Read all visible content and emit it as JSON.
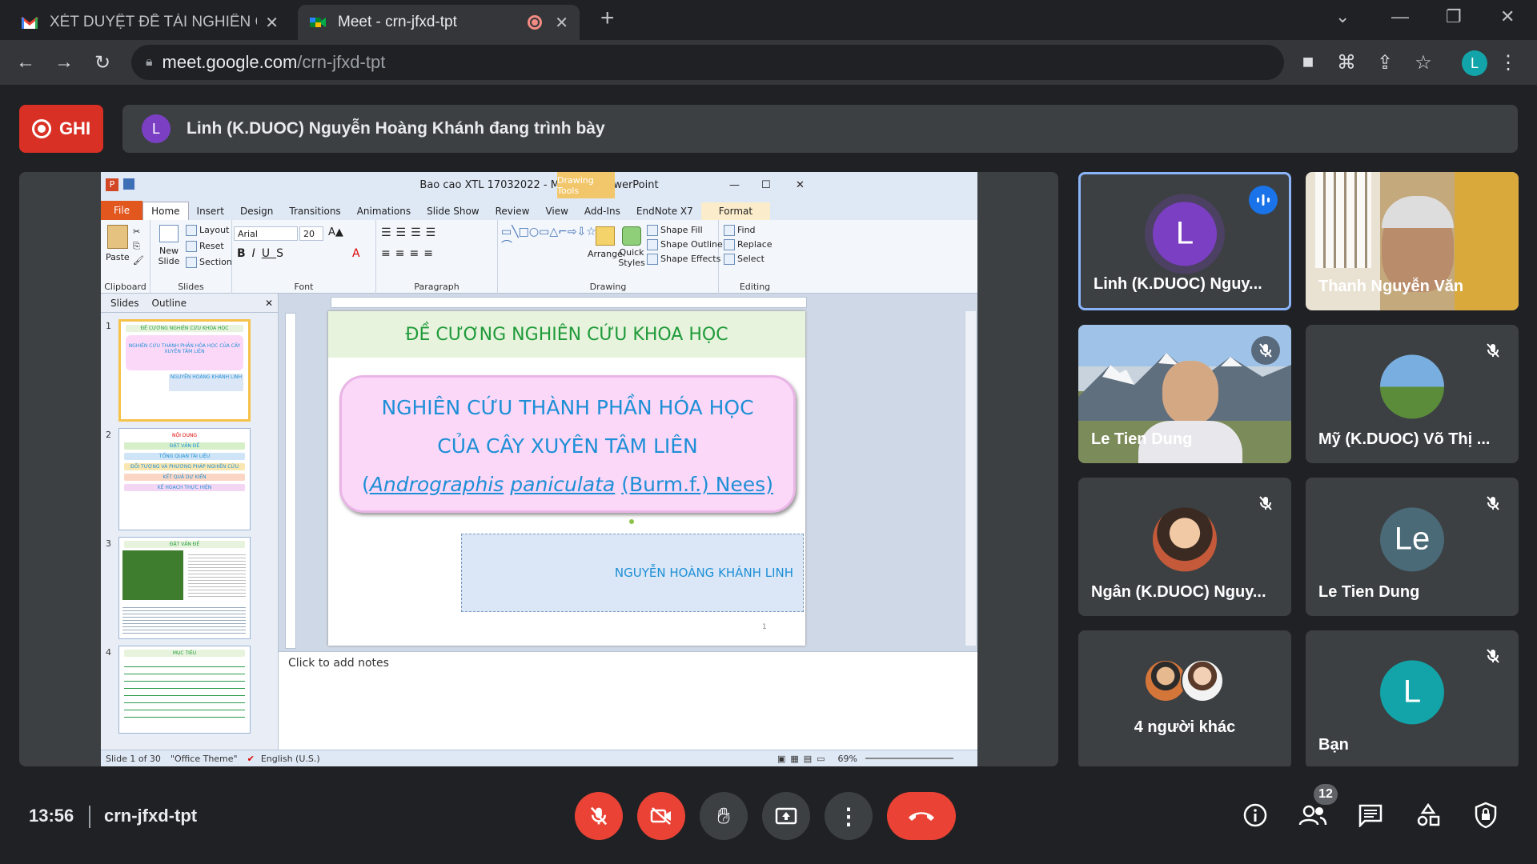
{
  "browser": {
    "tabs": [
      {
        "title": "XÉT DUYỆT ĐỀ TÀI NGHIÊN CỨU",
        "favicon": "gmail-icon"
      },
      {
        "title": "Meet - crn-jfxd-tpt",
        "favicon": "meet-icon"
      }
    ],
    "url_host": "meet.google.com",
    "url_path": "/crn-jfxd-tpt",
    "profile_initial": "L"
  },
  "meet": {
    "record_label": "GHI",
    "presenter_initial": "L",
    "presenting_text": "Linh (K.DUOC) Nguyễn Hoàng Khánh đang trình bày",
    "time": "13:56",
    "meeting_code": "crn-jfxd-tpt",
    "participant_count": "12",
    "participants": [
      {
        "name": "Linh (K.DUOC) Nguy...",
        "initial": "L",
        "color": "#7b3fc4",
        "speaking": true
      },
      {
        "name": "Thanh Nguyễn Văn",
        "type": "video"
      },
      {
        "name": "Le Tien Dung",
        "type": "video",
        "muted": true
      },
      {
        "name": "Mỹ (K.DUOC) Võ Thị ...",
        "muted": true
      },
      {
        "name": "Ngân (K.DUOC) Nguy...",
        "muted": true
      },
      {
        "name": "Le Tien Dung",
        "initial": "Le",
        "color": "#4a6a78",
        "muted": true
      },
      {
        "name": "4 người khác"
      },
      {
        "name": "Bạn",
        "initial": "L",
        "color": "#12a4a8",
        "muted": true
      }
    ]
  },
  "ppt": {
    "window_title": "Bao cao XTL 17032022 - Microsoft PowerPoint",
    "drawing_tools": "Drawing Tools",
    "tabs": [
      "File",
      "Home",
      "Insert",
      "Design",
      "Transitions",
      "Animations",
      "Slide Show",
      "Review",
      "View",
      "Add-Ins",
      "EndNote X7",
      "Format"
    ],
    "ribbon": {
      "clipboard": "Clipboard",
      "slides": "Slides",
      "font": "Font",
      "paragraph": "Paragraph",
      "drawing": "Drawing",
      "editing": "Editing",
      "paste": "Paste",
      "new_slide": "New Slide",
      "layout": "Layout",
      "reset": "Reset",
      "section": "Section",
      "font_name": "Arial",
      "font_size": "20",
      "arrange": "Arrange",
      "quick_styles": "Quick Styles",
      "shape_fill": "Shape Fill",
      "shape_outline": "Shape Outline",
      "shape_effects": "Shape Effects",
      "find": "Find",
      "replace": "Replace",
      "select": "Select"
    },
    "pane_tabs": [
      "Slides",
      "Outline"
    ],
    "thumbs": [
      {
        "num": "1",
        "lines": [
          "ĐỀ CƯƠNG NGHIÊN CỨU KHOA HỌC",
          "NGHIÊN CỨU THÀNH PHẦN HÓA HỌC CỦA CÂY XUYÊN TÂM LIÊN",
          "NGUYỄN HOÀNG KHÁNH LINH"
        ]
      },
      {
        "num": "2",
        "lines": [
          "NỘI DUNG",
          "ĐẶT VẤN ĐỀ",
          "TỔNG QUAN TÀI LIỆU",
          "ĐỐI TƯỢNG VÀ PHƯƠNG PHÁP NGHIÊN CỨU",
          "KẾT QUẢ DỰ KIẾN",
          "KẾ HOẠCH THỰC HIỆN"
        ]
      },
      {
        "num": "3",
        "lines": [
          "ĐẶT VẤN ĐỀ"
        ]
      },
      {
        "num": "4",
        "lines": [
          "MỤC TIÊU"
        ]
      }
    ],
    "slide": {
      "header": "ĐỀ CƯƠNG NGHIÊN CỨU KHOA HỌC",
      "line1": "NGHIÊN CỨU THÀNH PHẦN HÓA HỌC",
      "line2": "CỦA CÂY XUYÊN TÂM LIÊN",
      "open_paren": "(",
      "genus": "Andrographis",
      "species": "paniculata",
      "author": "(Burm.f.) Nees)",
      "subtitle": "NGUYỄN HOÀNG KHÁNH LINH",
      "page_num": "1"
    },
    "notes_placeholder": "Click to add notes",
    "status": {
      "slide": "Slide 1 of 30",
      "theme": "\"Office Theme\"",
      "lang": "English (U.S.)",
      "zoom": "69%"
    }
  }
}
